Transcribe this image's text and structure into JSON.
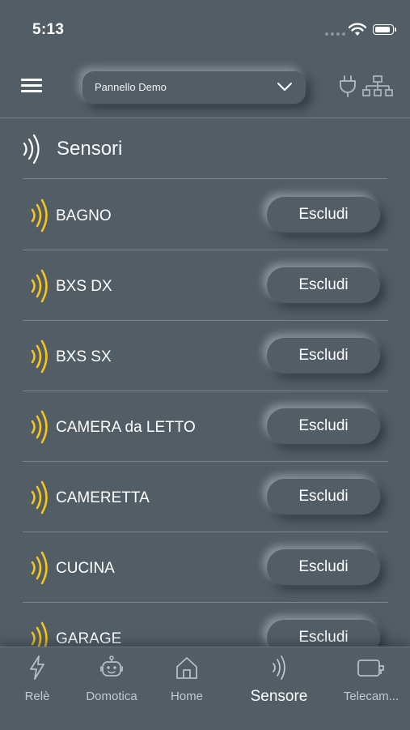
{
  "theme": {
    "background": "#535d66",
    "accent": "#f5c518",
    "divider": "#7a848d"
  },
  "status_bar": {
    "time": "5:13"
  },
  "header": {
    "panel_select": {
      "selected": "Pannello Demo"
    }
  },
  "section": {
    "title": "Sensori",
    "icon": "sensor-waves-icon"
  },
  "sensors": [
    {
      "name": "BAGNO",
      "action": "Escludi"
    },
    {
      "name": "BXS DX",
      "action": "Escludi"
    },
    {
      "name": "BXS SX",
      "action": "Escludi"
    },
    {
      "name": "CAMERA da LETTO",
      "action": "Escludi"
    },
    {
      "name": "CAMERETTA",
      "action": "Escludi"
    },
    {
      "name": "CUCINA",
      "action": "Escludi"
    },
    {
      "name": "GARAGE",
      "action": "Escludi"
    }
  ],
  "tabs": [
    {
      "label": "Relè",
      "icon": "lightning-icon"
    },
    {
      "label": "Domotica",
      "icon": "robot-icon"
    },
    {
      "label": "Home",
      "icon": "home-icon"
    },
    {
      "label": "Sensore",
      "icon": "sensor-waves-icon",
      "active": true
    },
    {
      "label": "Telecam...",
      "icon": "camera-icon"
    }
  ]
}
